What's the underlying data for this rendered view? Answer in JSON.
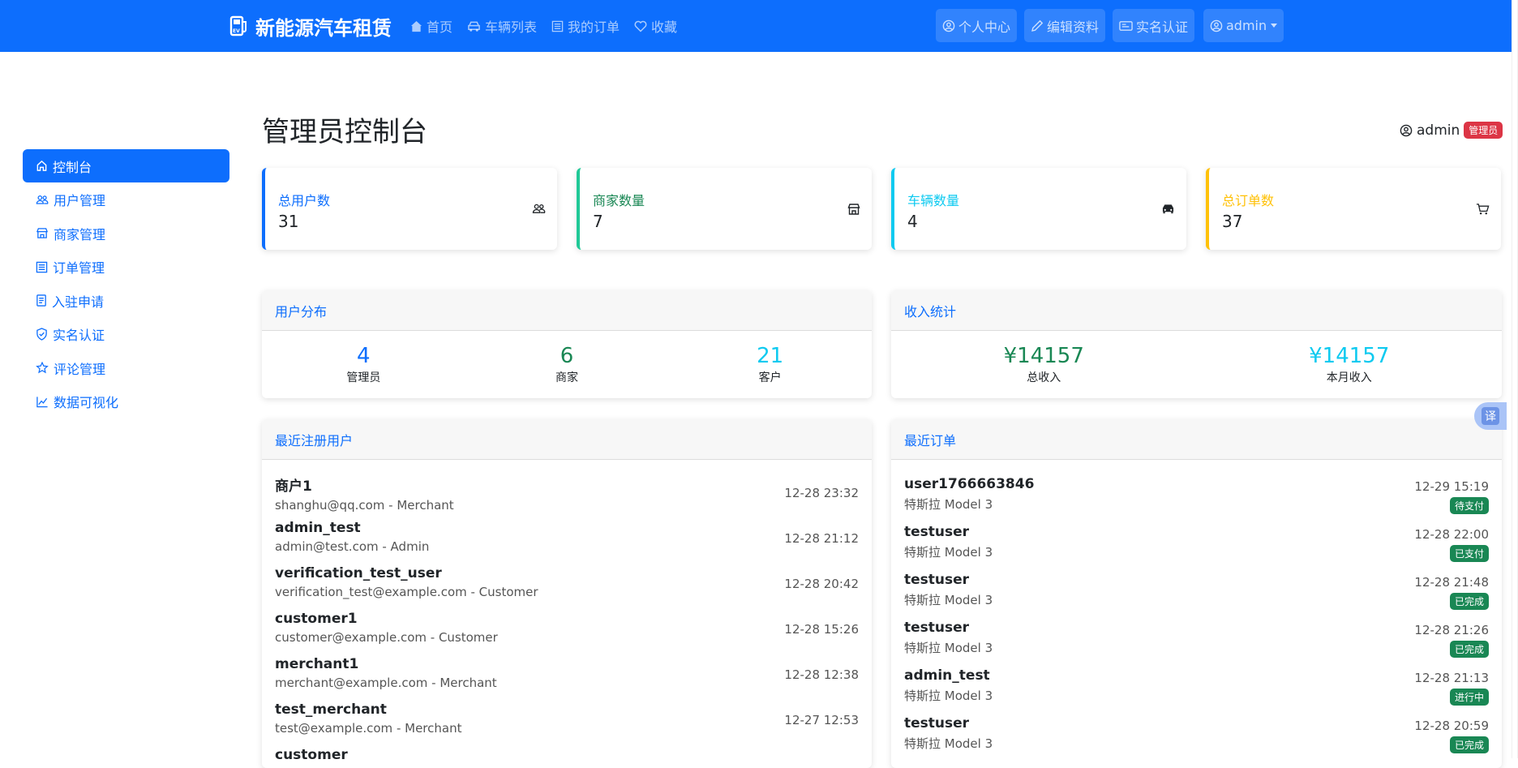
{
  "navbar": {
    "brand": "新能源汽车租赁",
    "links": [
      {
        "label": "首页",
        "icon": "house-icon"
      },
      {
        "label": "车辆列表",
        "icon": "car-icon"
      },
      {
        "label": "我的订单",
        "icon": "list-icon"
      },
      {
        "label": "收藏",
        "icon": "heart-icon"
      }
    ],
    "profile_label": "个人中心",
    "edit_label": "编辑资料",
    "verify_label": "实名认证",
    "user_label": "admin"
  },
  "sidebar": {
    "items": [
      {
        "label": "控制台",
        "icon": "house-icon",
        "active": true
      },
      {
        "label": "用户管理",
        "icon": "people-icon"
      },
      {
        "label": "商家管理",
        "icon": "shop-icon"
      },
      {
        "label": "订单管理",
        "icon": "list-icon"
      },
      {
        "label": "入驻申请",
        "icon": "document-icon"
      },
      {
        "label": "实名认证",
        "icon": "shield-icon"
      },
      {
        "label": "评论管理",
        "icon": "star-icon"
      },
      {
        "label": "数据可视化",
        "icon": "chart-icon"
      }
    ]
  },
  "header": {
    "title": "管理员控制台",
    "username": "admin",
    "role": "管理员"
  },
  "stats": [
    {
      "label": "总用户数",
      "value": "31",
      "color": "#0d6efd",
      "icon": "people-icon"
    },
    {
      "label": "商家数量",
      "value": "7",
      "color": "#198754",
      "icon": "shop-icon"
    },
    {
      "label": "车辆数量",
      "value": "4",
      "color": "#0dcaf0",
      "icon": "car-icon"
    },
    {
      "label": "总订单数",
      "value": "37",
      "color": "#ffc107",
      "icon": "cart-icon"
    }
  ],
  "user_dist": {
    "title": "用户分布",
    "items": [
      {
        "value": "4",
        "label": "管理员",
        "color": "#0d6efd"
      },
      {
        "value": "6",
        "label": "商家",
        "color": "#198754"
      },
      {
        "value": "21",
        "label": "客户",
        "color": "#0dcaf0"
      }
    ]
  },
  "income": {
    "title": "收入统计",
    "items": [
      {
        "value": "¥14157",
        "label": "总收入",
        "color": "#198754"
      },
      {
        "value": "¥14157",
        "label": "本月收入",
        "color": "#0dcaf0"
      }
    ]
  },
  "recent_users": {
    "title": "最近注册用户",
    "rows": [
      {
        "name": "商户1",
        "sub": "shanghu@qq.com - Merchant",
        "time": "12-28 23:32"
      },
      {
        "name": "admin_test",
        "sub": "admin@test.com - Admin",
        "time": "12-28 21:12"
      },
      {
        "name": "verification_test_user",
        "sub": "verification_test@example.com - Customer",
        "time": "12-28 20:42"
      },
      {
        "name": "customer1",
        "sub": "customer@example.com - Customer",
        "time": "12-28 15:26"
      },
      {
        "name": "merchant1",
        "sub": "merchant@example.com - Merchant",
        "time": "12-28 12:38"
      },
      {
        "name": "test_merchant",
        "sub": "test@example.com - Merchant",
        "time": "12-27 12:53"
      },
      {
        "name": "customer",
        "sub": "",
        "time": ""
      }
    ]
  },
  "recent_orders": {
    "title": "最近订单",
    "rows": [
      {
        "name": "user1766663846",
        "sub": "特斯拉 Model 3",
        "time": "12-29 15:19",
        "status": "待支付"
      },
      {
        "name": "testuser",
        "sub": "特斯拉 Model 3",
        "time": "12-28 22:00",
        "status": "已支付"
      },
      {
        "name": "testuser",
        "sub": "特斯拉 Model 3",
        "time": "12-28 21:48",
        "status": "已完成"
      },
      {
        "name": "testuser",
        "sub": "特斯拉 Model 3",
        "time": "12-28 21:26",
        "status": "已完成"
      },
      {
        "name": "admin_test",
        "sub": "特斯拉 Model 3",
        "time": "12-28 21:13",
        "status": "进行中"
      },
      {
        "name": "testuser",
        "sub": "特斯拉 Model 3",
        "time": "12-28 20:59",
        "status": "已完成"
      }
    ]
  },
  "translate": {
    "label": "译"
  }
}
